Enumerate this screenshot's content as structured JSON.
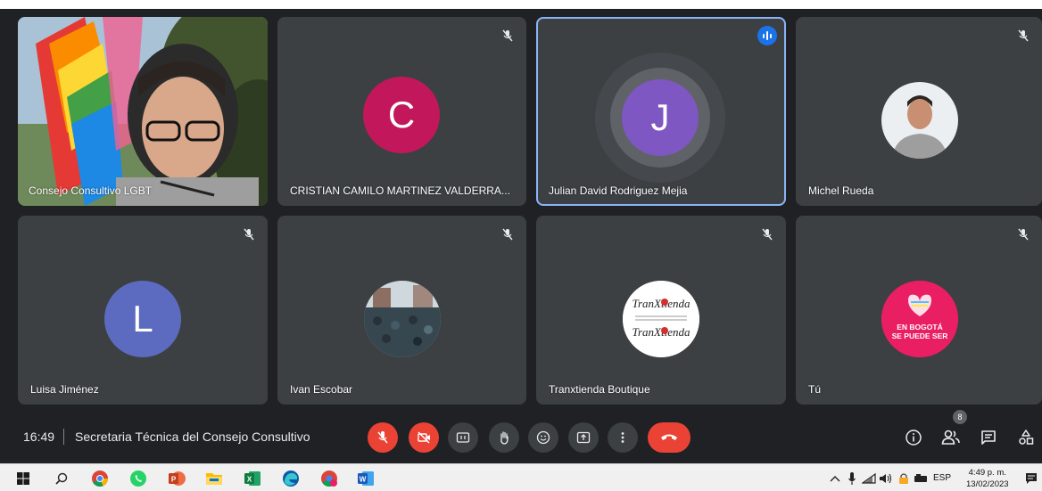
{
  "tiles": [
    {
      "name": "Consejo Consultivo LGBT"
    },
    {
      "name": "CRISTIAN CAMILO MARTINEZ VALDERRA...",
      "initial": "C",
      "color": "#c2185b"
    },
    {
      "name": "Julian David Rodriguez Mejia",
      "initial": "J",
      "color": "#7e57c2",
      "speaking": true
    },
    {
      "name": "Michel Rueda"
    },
    {
      "name": "Luisa Jiménez",
      "initial": "L",
      "color": "#5c6bc0"
    },
    {
      "name": "Ivan Escobar"
    },
    {
      "name": "Tranxtienda Boutique",
      "logo_text": "TranXtienda"
    },
    {
      "name": "Tú",
      "logo_text": "EN BOGOTÁ SE PUEDE SER"
    }
  ],
  "bottombar": {
    "time": "16:49",
    "meeting_name": "Secretaria Técnica del Consejo Consultivo",
    "participants_count": "8"
  },
  "taskbar": {
    "language": "ESP",
    "clock_time": "4:49 p. m.",
    "clock_date": "13/02/2023"
  },
  "colors": {
    "background": "#202124",
    "tile": "#3c4043",
    "red": "#ea4335",
    "speaking_blue": "#1a73e8"
  },
  "icons": [
    "mic-off-icon",
    "camera-off-icon",
    "captions-icon",
    "raise-hand-icon",
    "emoji-icon",
    "present-icon",
    "more-icon",
    "hang-up-icon",
    "info-icon",
    "people-icon",
    "chat-icon",
    "activities-icon"
  ]
}
